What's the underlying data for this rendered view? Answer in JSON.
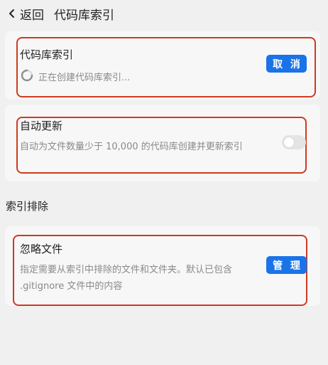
{
  "header": {
    "back_label": "返回",
    "title": "代码库索引"
  },
  "index_card": {
    "title": "代码库索引",
    "status": "正在创建代码库索引...",
    "cancel_label": "取 消"
  },
  "auto_update_card": {
    "title": "自动更新",
    "description": "自动为文件数量少于 10,000 的代码库创建并更新索引",
    "toggle_on": false
  },
  "exclusion_section": {
    "label": "索引排除"
  },
  "ignore_card": {
    "title": "忽略文件",
    "description": "指定需要从索引中排除的文件和文件夹。默认已包含 .gitignore 文件中的内容",
    "manage_label": "管 理"
  },
  "colors": {
    "accent": "#1a73e8",
    "highlight": "#cf3a1f"
  }
}
